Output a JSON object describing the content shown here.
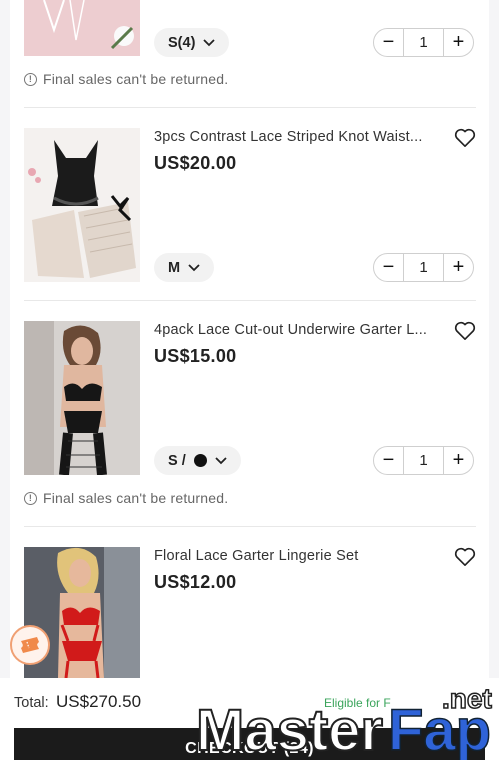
{
  "items": [
    {
      "variant": "S(4)",
      "quantity": "1",
      "notice": "Final sales can't be returned."
    },
    {
      "title": "3pcs Contrast Lace Striped Knot Waist...",
      "price": "US$20.00",
      "variant": "M",
      "quantity": "1"
    },
    {
      "title": "4pack Lace Cut-out Underwire Garter L...",
      "price": "US$15.00",
      "variant": "S /",
      "quantity": "1",
      "notice": "Final sales can't be returned."
    },
    {
      "title": "Floral Lace Garter Lingerie Set",
      "price": "US$12.00"
    }
  ],
  "footer": {
    "total_label": "Total:",
    "total_value": "US$270.50",
    "eligible_text": "Eligible for F",
    "checkout_label": "CHECKOUT (24)"
  },
  "watermark": {
    "main": "MasterFap",
    "suffix": ".net"
  },
  "colors": {
    "checkout_bg": "#1b1b1b",
    "eligible_green": "#3aa45b",
    "coupon_orange": "#f0a073",
    "watermark_blue": "#2f63d8"
  }
}
